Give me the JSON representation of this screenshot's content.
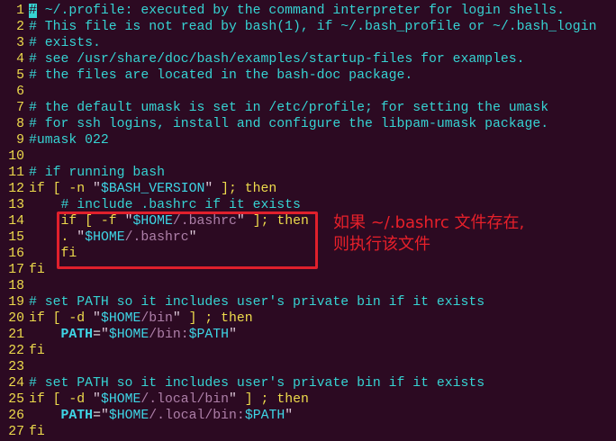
{
  "colors": {
    "background": "#2c0a22",
    "annotation": "#e0202c"
  },
  "lines": [
    {
      "n": "1",
      "tokens": [
        [
          "cur",
          "#"
        ],
        [
          "c",
          " ~/.profile: executed by the command interpreter for login shells."
        ]
      ]
    },
    {
      "n": "2",
      "tokens": [
        [
          "c",
          "# This file is not read by bash(1), if ~/.bash_profile or ~/.bash_login"
        ]
      ]
    },
    {
      "n": "3",
      "tokens": [
        [
          "c",
          "# exists."
        ]
      ]
    },
    {
      "n": "4",
      "tokens": [
        [
          "c",
          "# see /usr/share/doc/bash/examples/startup-files for examples."
        ]
      ]
    },
    {
      "n": "5",
      "tokens": [
        [
          "c",
          "# the files are located in the bash-doc package."
        ]
      ]
    },
    {
      "n": "6",
      "tokens": []
    },
    {
      "n": "7",
      "tokens": [
        [
          "c",
          "# the default umask is set in /etc/profile; for setting the umask"
        ]
      ]
    },
    {
      "n": "8",
      "tokens": [
        [
          "c",
          "# for ssh logins, install and configure the libpam-umask package."
        ]
      ]
    },
    {
      "n": "9",
      "tokens": [
        [
          "c",
          "#umask 022"
        ]
      ]
    },
    {
      "n": "10",
      "tokens": []
    },
    {
      "n": "11",
      "tokens": [
        [
          "c",
          "# if running bash"
        ]
      ]
    },
    {
      "n": "12",
      "tokens": [
        [
          "k",
          "if [ -n "
        ],
        [
          "q",
          "\""
        ],
        [
          "v",
          "$BASH_VERSION"
        ],
        [
          "q",
          "\""
        ],
        [
          "k",
          " ]; then"
        ]
      ]
    },
    {
      "n": "13",
      "tokens": [
        [
          "p",
          "    "
        ],
        [
          "c",
          "# include .bashrc if it exists"
        ]
      ]
    },
    {
      "n": "14",
      "tokens": [
        [
          "p",
          "    "
        ],
        [
          "k",
          "if [ -f "
        ],
        [
          "q",
          "\""
        ],
        [
          "v",
          "$HOME"
        ],
        [
          "s",
          "/.bashrc"
        ],
        [
          "q",
          "\""
        ],
        [
          "k",
          " ]; then"
        ]
      ]
    },
    {
      "n": "15",
      "tokens": [
        [
          "p",
          "    "
        ],
        [
          "k",
          ". "
        ],
        [
          "q",
          "\""
        ],
        [
          "v",
          "$HOME"
        ],
        [
          "s",
          "/.bashrc"
        ],
        [
          "q",
          "\""
        ]
      ]
    },
    {
      "n": "16",
      "tokens": [
        [
          "p",
          "    "
        ],
        [
          "k",
          "fi"
        ]
      ]
    },
    {
      "n": "17",
      "tokens": [
        [
          "k",
          "fi"
        ]
      ]
    },
    {
      "n": "18",
      "tokens": []
    },
    {
      "n": "19",
      "tokens": [
        [
          "c",
          "# set PATH so it includes user's private bin if it exists"
        ]
      ]
    },
    {
      "n": "20",
      "tokens": [
        [
          "k",
          "if [ -d "
        ],
        [
          "q",
          "\""
        ],
        [
          "v",
          "$HOME"
        ],
        [
          "s",
          "/bin"
        ],
        [
          "q",
          "\""
        ],
        [
          "k",
          " ] ; then"
        ]
      ]
    },
    {
      "n": "21",
      "tokens": [
        [
          "p",
          "    "
        ],
        [
          "b",
          "PATH"
        ],
        [
          "p",
          "="
        ],
        [
          "q",
          "\""
        ],
        [
          "v",
          "$HOME"
        ],
        [
          "s",
          "/bin:"
        ],
        [
          "v",
          "$PATH"
        ],
        [
          "q",
          "\""
        ]
      ]
    },
    {
      "n": "22",
      "tokens": [
        [
          "k",
          "fi"
        ]
      ]
    },
    {
      "n": "23",
      "tokens": []
    },
    {
      "n": "24",
      "tokens": [
        [
          "c",
          "# set PATH so it includes user's private bin if it exists"
        ]
      ]
    },
    {
      "n": "25",
      "tokens": [
        [
          "k",
          "if [ -d "
        ],
        [
          "q",
          "\""
        ],
        [
          "v",
          "$HOME"
        ],
        [
          "s",
          "/.local/bin"
        ],
        [
          "q",
          "\""
        ],
        [
          "k",
          " ] ; then"
        ]
      ]
    },
    {
      "n": "26",
      "tokens": [
        [
          "p",
          "    "
        ],
        [
          "b",
          "PATH"
        ],
        [
          "p",
          "="
        ],
        [
          "q",
          "\""
        ],
        [
          "v",
          "$HOME"
        ],
        [
          "s",
          "/.local/bin:"
        ],
        [
          "v",
          "$PATH"
        ],
        [
          "q",
          "\""
        ]
      ]
    },
    {
      "n": "27",
      "tokens": [
        [
          "k",
          "fi"
        ]
      ]
    }
  ],
  "annotation": {
    "line1": "如果 ~/.bashrc 文件存在,",
    "line2": "则执行该文件"
  }
}
